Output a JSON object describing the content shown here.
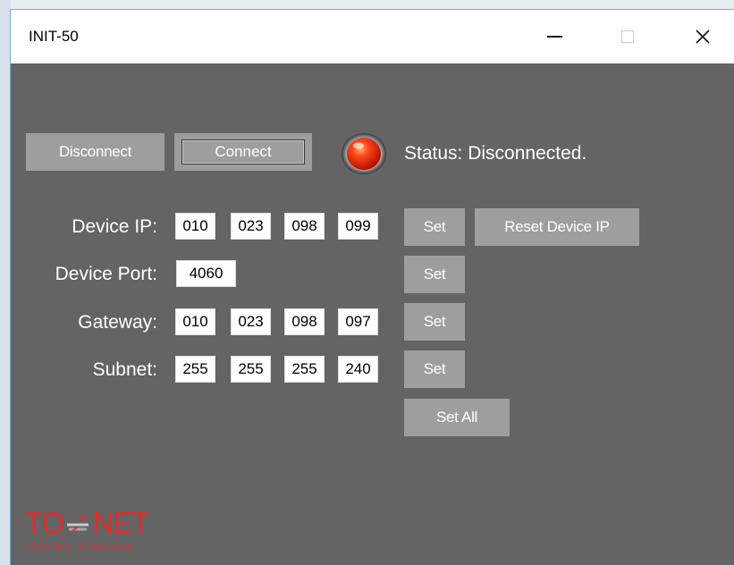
{
  "window": {
    "title": "INIT-50",
    "controls": {
      "minimize": "minimize-icon",
      "maximize": "maximize-icon",
      "close": "close-icon"
    }
  },
  "connection": {
    "disconnect_label": "Disconnect",
    "connect_label": "Connect",
    "status_text": "Status: Disconnected.",
    "led_color": "#e0220f"
  },
  "form": {
    "device_ip": {
      "label": "Device IP:",
      "octets": [
        "010",
        "023",
        "098",
        "099"
      ]
    },
    "device_port": {
      "label": "Device Port:",
      "value": "4060"
    },
    "gateway": {
      "label": "Gateway:",
      "octets": [
        "010",
        "023",
        "098",
        "097"
      ]
    },
    "subnet": {
      "label": "Subnet:",
      "octets": [
        "255",
        "255",
        "255",
        "240"
      ]
    }
  },
  "actions": {
    "set_label": "Set",
    "reset_device_ip_label": "Reset Device IP",
    "set_all_label": "Set All"
  },
  "logo": {
    "main": "TO NET",
    "tagline": "complete IT solutions",
    "color": "#e52b2b"
  },
  "colors": {
    "window_bg": "#646464",
    "button_bg": "#9e9e9e",
    "titlebar_bg": "#ffffff"
  }
}
